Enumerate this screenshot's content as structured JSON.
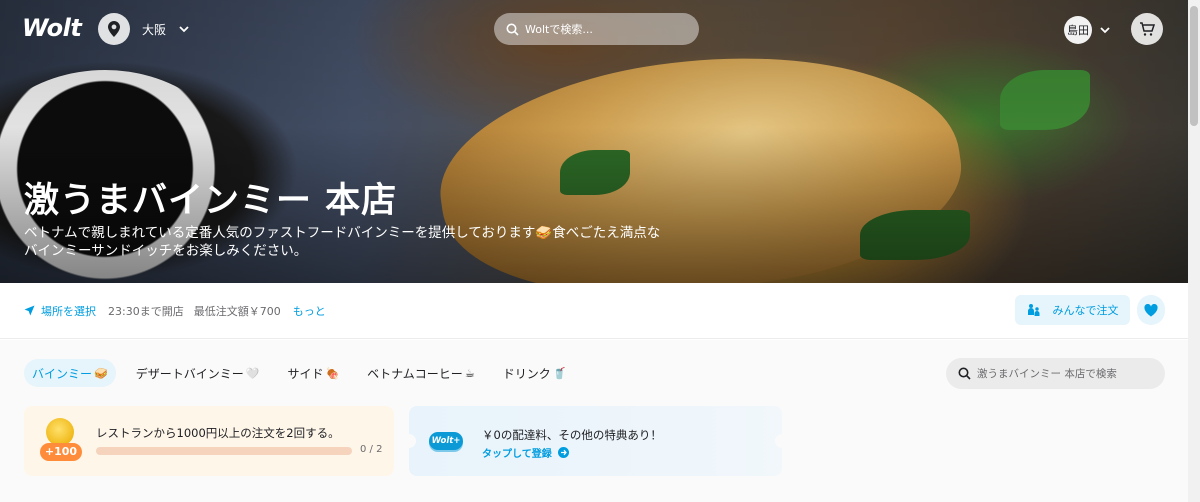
{
  "header": {
    "logo": "Wolt",
    "location": "大阪",
    "search_placeholder": "Woltで検索...",
    "user": "島田"
  },
  "venue": {
    "name": "激うまバインミー 本店",
    "description": "ベトナムで親しまれている定番人気のファストフードバインミーを提供しております🥪食べごたえ満点なバインミーサンドイッチをお楽しみください。"
  },
  "info": {
    "choose_location": "場所を選択",
    "hours": "23:30まで開店",
    "min_order": "最低注文額￥700",
    "more": "もっと",
    "group_order": "みんなで注文"
  },
  "categories": [
    {
      "label": "バインミー",
      "emoji": "🥪"
    },
    {
      "label": "デザートバインミー",
      "emoji": "🤍"
    },
    {
      "label": "サイド",
      "emoji": "🍖"
    },
    {
      "label": "ベトナムコーヒー",
      "emoji": "☕"
    },
    {
      "label": "ドリンク",
      "emoji": "🥤"
    }
  ],
  "menu_search_placeholder": "激うまバインミー 本店で検索",
  "mission": {
    "bonus": "+100",
    "text": "レストランから1000円以上の注文を2回する。",
    "progress_fraction": 0,
    "count": "0 / 2"
  },
  "wolt_plus": {
    "badge": "Wolt+",
    "headline": "￥0の配達料、その他の特典あり！",
    "cta": "タップして登録"
  },
  "colors": {
    "accent": "#009de0",
    "accent_bg": "#e6f4fb",
    "bonus": "#ff8c3a"
  }
}
